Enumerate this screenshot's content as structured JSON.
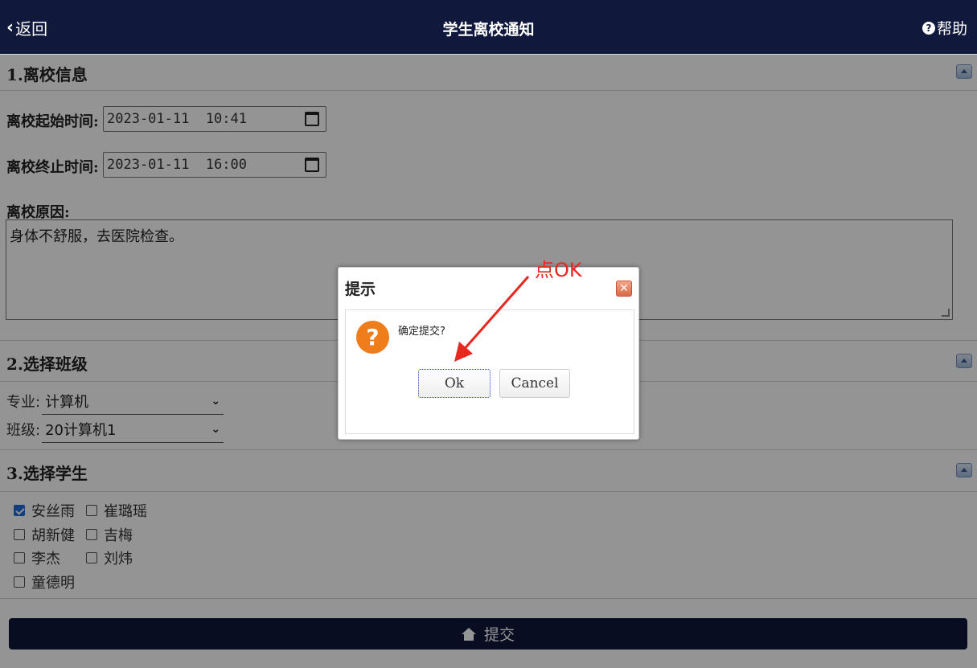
{
  "header": {
    "back_label": "返回",
    "title": "学生离校通知",
    "help_label": "帮助"
  },
  "section1": {
    "title": "1.离校信息",
    "start_label": "离校起始时间:",
    "start_value": "2023-01-11  10:41",
    "end_label": "离校终止时间:",
    "end_value": "2023-01-11  16:00",
    "reason_label": "离校原因:",
    "reason_value": "身体不舒服，去医院检查。"
  },
  "section2": {
    "title": "2.选择班级",
    "major_label": "专业:",
    "major_value": "计算机",
    "class_label": "班级:",
    "class_value": "20计算机1"
  },
  "section3": {
    "title": "3.选择学生",
    "students": [
      {
        "name": "安丝雨",
        "checked": true
      },
      {
        "name": "崔璐瑶",
        "checked": false
      },
      {
        "name": "胡新健",
        "checked": false
      },
      {
        "name": "吉梅",
        "checked": false
      },
      {
        "name": "李杰",
        "checked": false
      },
      {
        "name": "刘炜",
        "checked": false
      },
      {
        "name": "童德明",
        "checked": false
      }
    ]
  },
  "submit_label": "提交",
  "dialog": {
    "title": "提示",
    "message": "确定提交?",
    "ok_label": "Ok",
    "cancel_label": "Cancel"
  },
  "annotation": {
    "text": "点OK"
  },
  "colors": {
    "header_bg": "#10183b",
    "accent_checkbox": "#1a6fd8",
    "question_icon": "#f07d1b",
    "annotation": "#e8271f"
  }
}
